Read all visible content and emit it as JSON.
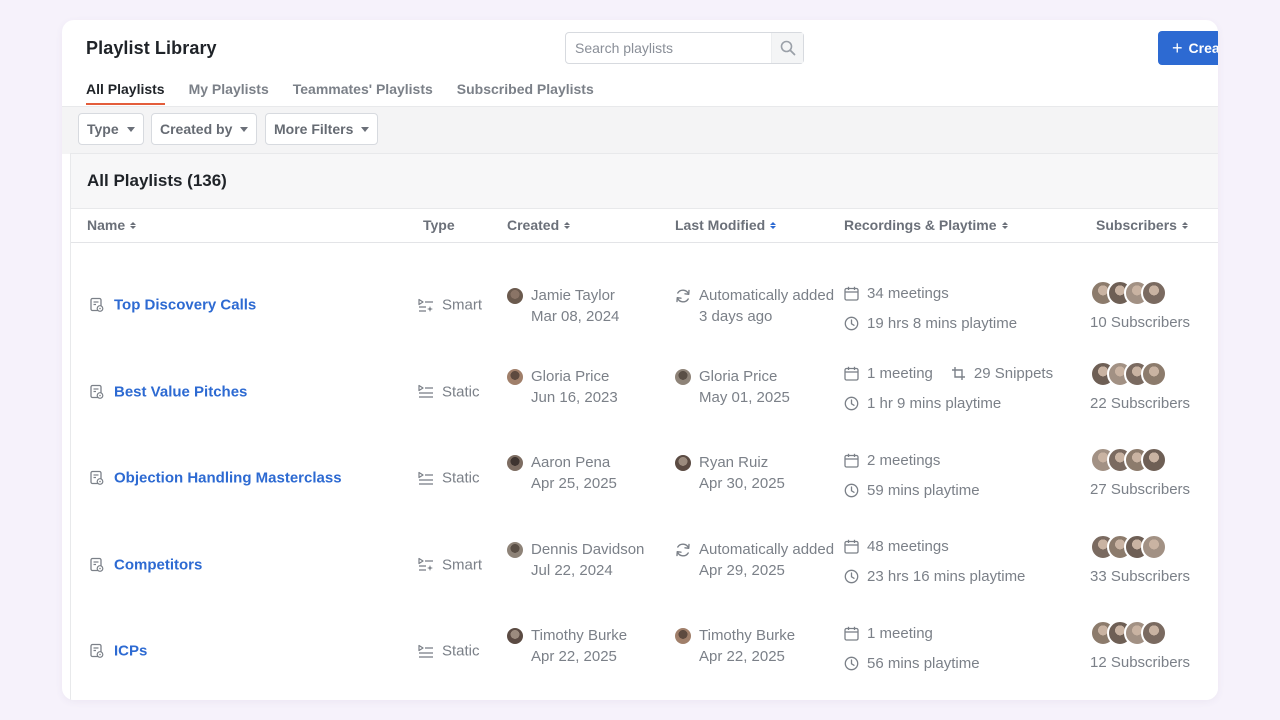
{
  "header": {
    "title": "Playlist Library",
    "search_placeholder": "Search playlists",
    "create_label": "Crea"
  },
  "tabs": [
    {
      "label": "All Playlists",
      "active": true
    },
    {
      "label": "My Playlists"
    },
    {
      "label": "Teammates' Playlists"
    },
    {
      "label": "Subscribed Playlists"
    }
  ],
  "filters": [
    {
      "label": "Type"
    },
    {
      "label": "Created by"
    },
    {
      "label": "More Filters"
    }
  ],
  "panel": {
    "heading": "All Playlists (136)"
  },
  "columns": {
    "name": "Name",
    "type": "Type",
    "created": "Created",
    "modified": "Last Modified",
    "recordings": "Recordings & Playtime",
    "subscribers": "Subscribers"
  },
  "rows": [
    {
      "name": "Top Discovery Calls",
      "type": "Smart",
      "created_by": "Jamie Taylor",
      "created_date": "Mar 08, 2024",
      "modified_by": "Automatically added",
      "modified_date": "3 days ago",
      "modified_auto": true,
      "meetings": "34 meetings",
      "snippets": "",
      "playtime": "19 hrs 8 mins playtime",
      "subscribers": "10 Subscribers"
    },
    {
      "name": "Best Value Pitches",
      "type": "Static",
      "created_by": "Gloria Price",
      "created_date": "Jun 16, 2023",
      "modified_by": "Gloria Price",
      "modified_date": "May 01, 2025",
      "modified_auto": false,
      "meetings": "1 meeting",
      "snippets": "29 Snippets",
      "playtime": "1 hr 9 mins playtime",
      "subscribers": "22 Subscribers"
    },
    {
      "name": "Objection Handling Masterclass",
      "type": "Static",
      "created_by": "Aaron Pena",
      "created_date": "Apr 25, 2025",
      "modified_by": "Ryan Ruiz",
      "modified_date": "Apr 30, 2025",
      "modified_auto": false,
      "meetings": "2 meetings",
      "snippets": "",
      "playtime": "59 mins playtime",
      "subscribers": "27 Subscribers"
    },
    {
      "name": "Competitors",
      "type": "Smart",
      "created_by": "Dennis Davidson",
      "created_date": "Jul 22, 2024",
      "modified_by": "Automatically added",
      "modified_date": "Apr 29, 2025",
      "modified_auto": true,
      "meetings": "48 meetings",
      "snippets": "",
      "playtime": "23 hrs 16 mins playtime",
      "subscribers": "33 Subscribers"
    },
    {
      "name": "ICPs",
      "type": "Static",
      "created_by": "Timothy Burke",
      "created_date": "Apr 22, 2025",
      "modified_by": "Timothy Burke",
      "modified_date": "Apr 22, 2025",
      "modified_auto": false,
      "meetings": "1 meeting",
      "snippets": "",
      "playtime": "56 mins playtime",
      "subscribers": "12 Subscribers"
    }
  ],
  "colors": {
    "accent": "#2d6ad2",
    "tab_underline": "#e35d3b",
    "muted_text": "#7b8088"
  }
}
